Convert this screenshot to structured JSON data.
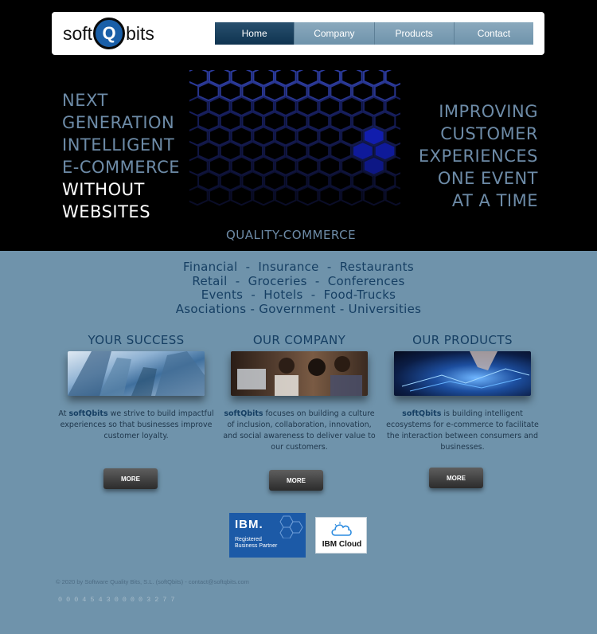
{
  "header": {
    "logo_left": "soft",
    "logo_mid": "Q",
    "logo_right": "bits",
    "nav": [
      {
        "label": "Home",
        "active": true
      },
      {
        "label": "Company",
        "active": false
      },
      {
        "label": "Products",
        "active": false
      },
      {
        "label": "Contact",
        "active": false
      }
    ]
  },
  "hero": {
    "left_lines": [
      "NEXT",
      "GENERATION",
      "INTELLIGENT",
      "E-COMMERCE"
    ],
    "left_highlight": [
      "WITHOUT",
      "WEBSITES"
    ],
    "right_lines": [
      "IMPROVING",
      "CUSTOMER",
      "EXPERIENCES",
      "ONE EVENT",
      "AT A TIME"
    ],
    "tagline": "QUALITY-COMMERCE"
  },
  "industries": [
    "Financial  -  Insurance  -  Restaurants",
    "Retail  -  Groceries  -  Conferences",
    "Events  -  Hotels  -  Food-Trucks",
    "Asociations - Government - Universities"
  ],
  "columns": [
    {
      "title": "YOUR SUCCESS",
      "text_pre": "At ",
      "brand": "softQbits",
      "text_post": " we strive to build impactful experiences so that businesses improve customer loyalty.",
      "more_label": "MORE"
    },
    {
      "title": "OUR COMPANY",
      "text_pre": "",
      "brand": "softQbits",
      "text_post": " focuses on building a culture of inclusion, collaboration, innovation, and social awareness to deliver value to our customers.",
      "more_label": "MORE"
    },
    {
      "title": "OUR PRODUCTS",
      "text_pre": "",
      "brand": "softQbits",
      "text_post": " is building intelligent ecosystems for e-commerce to facilitate the interaction between consumers and businesses.",
      "more_label": "MORE"
    }
  ],
  "badges": {
    "ibm_logo": "IBM.",
    "ibm_registered_1": "Registered",
    "ibm_registered_2": "Business Partner",
    "ibm_cloud": "IBM Cloud"
  },
  "footer": {
    "copyright": "© 2020 by Software Quality Bits, S.L.  (softQbits)  -  contact@softqbits.com",
    "counter": "000454300003277"
  },
  "colors": {
    "accent": "#163f63",
    "background": "#6f93ab",
    "hero_text": "#6d8ba7"
  }
}
